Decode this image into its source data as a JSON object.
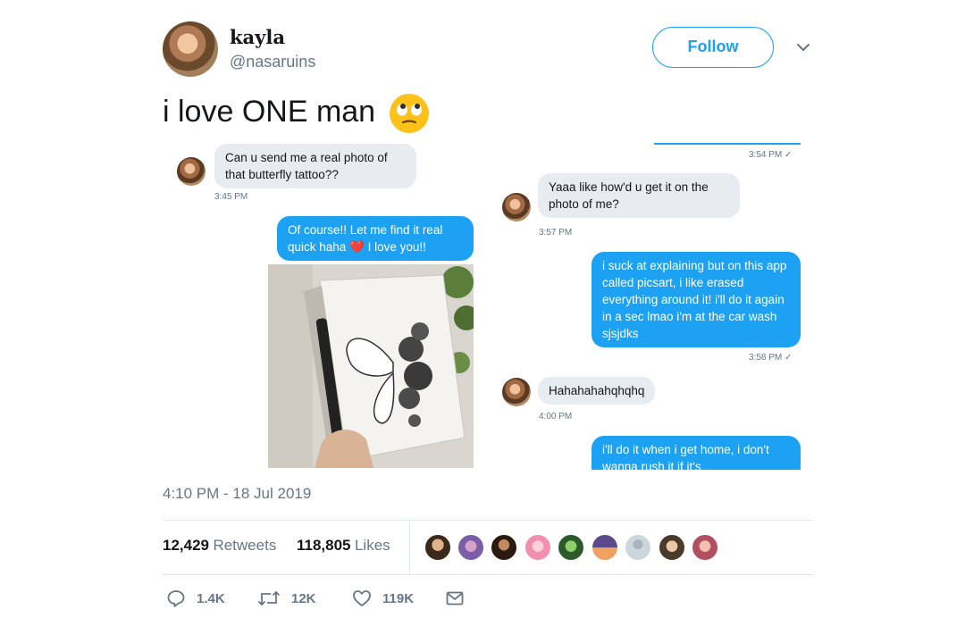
{
  "user": {
    "name": "kayla",
    "handle": "@nasaruins"
  },
  "follow_label": "Follow",
  "tweet_text": "i love ONE man",
  "chat": {
    "left": [
      {
        "text": "Can u send me a real photo of that butterfly tattoo??",
        "time": "3:45 PM"
      },
      {
        "text": "Of course!! Let me find it real quick haha ❤️ I love you!!"
      }
    ],
    "right": [
      {
        "time": "3:54 PM ✓"
      },
      {
        "text": "Yaaa like how'd u get it on the photo of me?",
        "time": "3:57 PM"
      },
      {
        "text": "i suck at explaining but on this app called picsart, i like erased everything around it! i'll do it again in a sec lmao i'm at the car wash sjsjdks",
        "time": "3:58 PM ✓"
      },
      {
        "text": "Hahahahahqhqhq",
        "time": "4:00 PM"
      },
      {
        "text": "i'll do it when i get home, i don't wanna rush it if it's"
      }
    ]
  },
  "timestamp": "4:10 PM - 18 Jul 2019",
  "stats": {
    "retweets": "12,429",
    "retweets_label": "Retweets",
    "likes": "118,805",
    "likes_label": "Likes"
  },
  "actions": {
    "replies": "1.4K",
    "retweets": "12K",
    "likes": "119K"
  },
  "icons": [
    "chevron-down-icon",
    "eye-roll-emoji",
    "reply-icon",
    "retweet-icon",
    "heart-icon",
    "mail-icon"
  ],
  "colors": {
    "accent": "#1da1f2",
    "muted": "#657786",
    "bubble_gray": "#e6ecf0"
  }
}
